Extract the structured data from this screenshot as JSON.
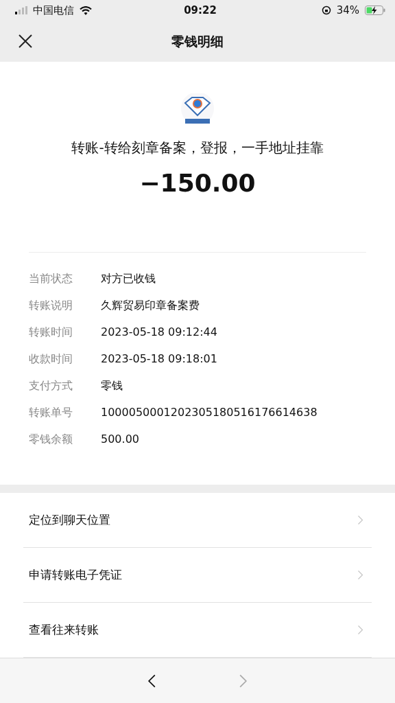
{
  "status_bar": {
    "carrier": "中国电信",
    "time": "09:22",
    "battery": "34%"
  },
  "nav": {
    "title": "零钱明细"
  },
  "summary": {
    "description": "转账-转给刻章备案，登报，一手地址挂靠",
    "amount": "−150.00"
  },
  "details": [
    {
      "label": "当前状态",
      "value": "对方已收钱"
    },
    {
      "label": "转账说明",
      "value": "久辉贸易印章备案费"
    },
    {
      "label": "转账时间",
      "value": "2023-05-18 09:12:44"
    },
    {
      "label": "收款时间",
      "value": "2023-05-18 09:18:01"
    },
    {
      "label": "支付方式",
      "value": "零钱"
    },
    {
      "label": "转账单号",
      "value": "1000050001202305180516176614638"
    },
    {
      "label": "零钱余额",
      "value": "500.00"
    }
  ],
  "actions": [
    {
      "label": "定位到聊天位置"
    },
    {
      "label": "申请转账电子凭证"
    },
    {
      "label": "查看往来转账"
    }
  ],
  "toolbar": {
    "back": {
      "disabled": false
    },
    "forward": {
      "disabled": true
    }
  }
}
